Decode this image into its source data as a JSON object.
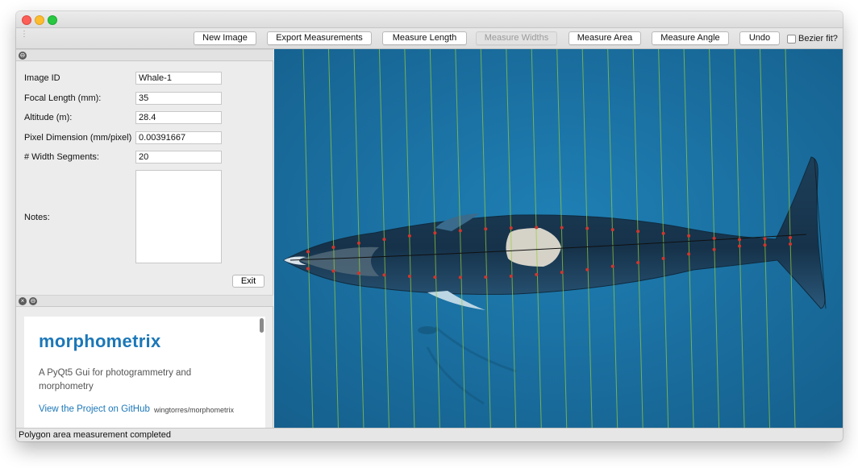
{
  "toolbar": {
    "buttons": {
      "new_image": "New Image",
      "export_measurements": "Export Measurements",
      "measure_length": "Measure Length",
      "measure_widths": "Measure Widths",
      "measure_area": "Measure Area",
      "measure_angle": "Measure Angle",
      "undo": "Undo"
    },
    "bezier_label": "Bezier fit?",
    "bezier_checked": false
  },
  "form": {
    "image_id": {
      "label": "Image ID",
      "value": "Whale-1"
    },
    "focal_length": {
      "label": "Focal Length (mm):",
      "value": "35"
    },
    "altitude": {
      "label": "Altitude (m):",
      "value": "28.4"
    },
    "pixel_dimension": {
      "label": "Pixel Dimension (mm/pixel)",
      "value": "0.00391667"
    },
    "width_segments": {
      "label": "# Width Segments:",
      "value": "20"
    },
    "notes": {
      "label": "Notes:",
      "value": ""
    },
    "exit_label": "Exit"
  },
  "web": {
    "title": "morphometrix",
    "subtitle": "A PyQt5 Gui for photogrammetry and morphometry",
    "link_text": "View the Project on GitHub",
    "repo": "wingtorres/morphometrix"
  },
  "status": {
    "message": "Polygon area measurement completed"
  },
  "colors": {
    "water": "#1b73a3",
    "width_line": "#9bcf3a",
    "point": "#d2352a",
    "area_fill": "#e6e0d2"
  }
}
